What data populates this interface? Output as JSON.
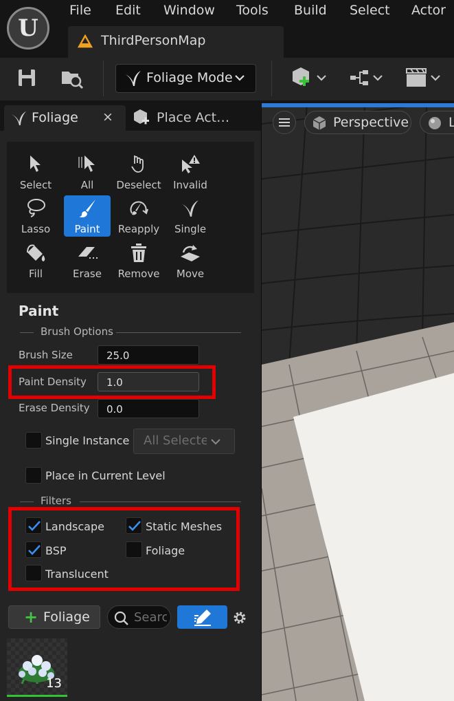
{
  "menu": {
    "items": [
      "File",
      "Edit",
      "Window",
      "Tools",
      "Build",
      "Select",
      "Actor"
    ]
  },
  "document_tab": {
    "label": "ThirdPersonMap"
  },
  "toolbar": {
    "mode_select": {
      "value": "Foliage Mode"
    }
  },
  "panel_tabs": {
    "foliage": {
      "label": "Foliage",
      "close": "×"
    },
    "place_actors": {
      "label": "Place Act…"
    }
  },
  "tools": [
    {
      "label": "Select",
      "icon": "cursor-icon",
      "active": false
    },
    {
      "label": "All",
      "icon": "select-all-icon",
      "active": false
    },
    {
      "label": "Deselect",
      "icon": "deselect-icon",
      "active": false
    },
    {
      "label": "Invalid",
      "icon": "invalid-icon",
      "active": false
    },
    {
      "label": "Lasso",
      "icon": "lasso-icon",
      "active": false
    },
    {
      "label": "Paint",
      "icon": "paint-brush-icon",
      "active": true
    },
    {
      "label": "Reapply",
      "icon": "reapply-icon",
      "active": false
    },
    {
      "label": "Single",
      "icon": "single-icon",
      "active": false
    },
    {
      "label": "Fill",
      "icon": "fill-bucket-icon",
      "active": false
    },
    {
      "label": "Erase",
      "icon": "eraser-icon",
      "active": false
    },
    {
      "label": "Remove",
      "icon": "trash-icon",
      "active": false
    },
    {
      "label": "Move",
      "icon": "move-icon",
      "active": false
    }
  ],
  "paint": {
    "title": "Paint",
    "brush_options": {
      "title": "Brush Options",
      "brush_size": {
        "label": "Brush Size",
        "value": "25.0"
      },
      "paint_density": {
        "label": "Paint Density",
        "value": "1.0"
      },
      "erase_density": {
        "label": "Erase Density",
        "value": "0.0"
      }
    },
    "single_instance_mode": {
      "label": "Single Instance Mode",
      "checked": false,
      "dropdown": "All Selected"
    },
    "place_in_current_level": {
      "label": "Place in Current Level",
      "checked": false
    },
    "filters": {
      "title": "Filters",
      "landscape": {
        "label": "Landscape",
        "checked": true
      },
      "static_meshes": {
        "label": "Static Meshes",
        "checked": true
      },
      "bsp": {
        "label": "BSP",
        "checked": true
      },
      "foliage": {
        "label": "Foliage",
        "checked": false
      },
      "translucent": {
        "label": "Translucent",
        "checked": false
      }
    }
  },
  "foliage_list": {
    "add_button": {
      "label": "Foliage"
    },
    "search": {
      "placeholder": "Search"
    },
    "items": [
      {
        "count": "13"
      }
    ]
  },
  "viewport": {
    "perspective_label": "Perspective",
    "lit_label": "Lit"
  },
  "colors": {
    "accent": "#1f77d8",
    "highlight_box": "#e30000",
    "add_green": "#46c246"
  }
}
